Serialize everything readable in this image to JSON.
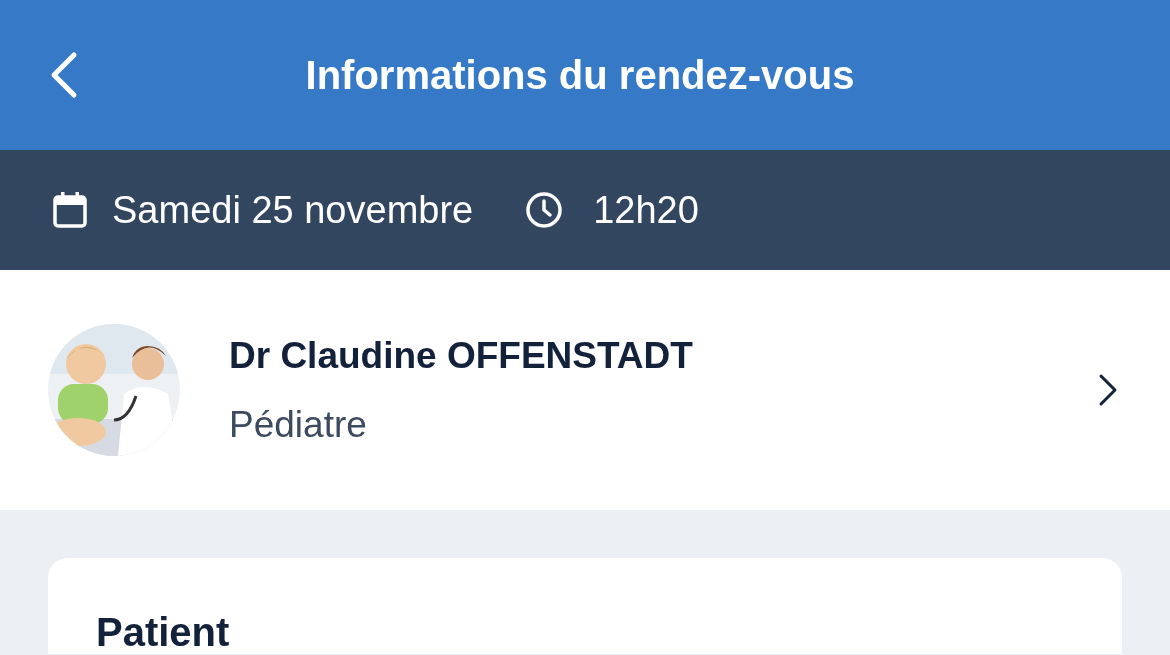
{
  "header": {
    "title": "Informations du rendez-vous"
  },
  "schedule": {
    "date": "Samedi 25 novembre",
    "time": "12h20"
  },
  "practitioner": {
    "name": "Dr Claudine OFFENSTADT",
    "specialty": "Pédiatre"
  },
  "card": {
    "title": "Patient"
  }
}
